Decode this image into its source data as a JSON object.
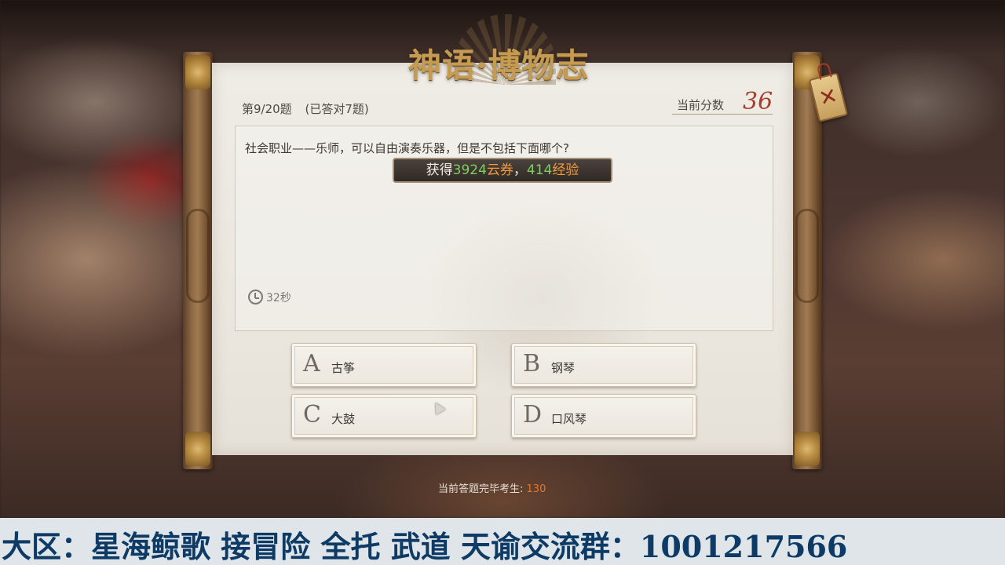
{
  "game_title": "神语·博物志",
  "progress": {
    "question_index": "第9/20题",
    "correct_count": "(已答对7题)"
  },
  "score": {
    "label": "当前分数",
    "value": "36"
  },
  "question": {
    "text": "社会职业——乐师，可以自由演奏乐器，但是不包括下面哪个?"
  },
  "reward": {
    "prefix": "获得",
    "coupon_amount": "3924",
    "coupon_unit": "云券",
    "separator": "，",
    "exp_amount": "414",
    "exp_unit": "经验"
  },
  "timer": {
    "text": "32秒"
  },
  "options": [
    {
      "letter": "A",
      "text": "古筝"
    },
    {
      "letter": "B",
      "text": "钢琴"
    },
    {
      "letter": "C",
      "text": "大鼓"
    },
    {
      "letter": "D",
      "text": "口风琴"
    }
  ],
  "finished": {
    "label": "当前答题完毕考生:",
    "value": "130"
  },
  "bottom_banner": {
    "text": "大区：星海鲸歌 接冒险 全托 武道 天谕交流群：1001217566"
  },
  "colors": {
    "score_red": "#a5402f",
    "reward_green": "#7ecf5f",
    "reward_orange": "#f29b3a",
    "banner_text": "#0d3b66"
  },
  "icons": {
    "close": "close-x-tag-icon",
    "timer": "clock-icon"
  }
}
